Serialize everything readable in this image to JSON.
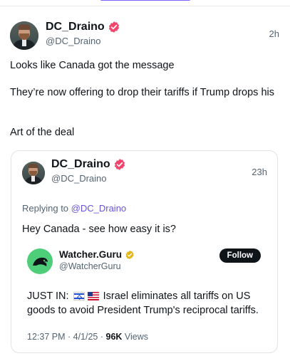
{
  "post": {
    "display_name": "DC_Draino",
    "handle": "@DC_Draino",
    "time": "2h",
    "text_lines": [
      "Looks like Canada got the message",
      "They’re now offering to drop their tariffs if Trump drops his",
      "Art of the deal"
    ]
  },
  "quoted": {
    "display_name": "DC_Draino",
    "handle": "@DC_Draino",
    "time": "23h",
    "reply_prefix": "Replying to ",
    "reply_mention": "@DC_Draino",
    "text": "Hey Canada - see how easy it is?",
    "embedded": {
      "display_name": "Watcher.Guru",
      "handle": "@WatcherGuru",
      "follow_label": "Follow",
      "text_prefix": "JUST IN: ",
      "text_body": " Israel eliminates all tariffs on US goods to avoid President Trump's reciprocal tariffs."
    },
    "meta": {
      "time": "12:37 PM",
      "sep1": " · ",
      "date": "4/1/25",
      "sep2": " · ",
      "views_count": "96K",
      "views_label": " Views"
    }
  },
  "colors": {
    "accent": "#7b61ff",
    "verified_badge": "#f0466e",
    "mention": "#6a52d8",
    "watcher_avatar": "#4fce7a"
  },
  "icons": [
    "verified-badge-icon",
    "gold-verified-badge-icon",
    "israel-flag-icon",
    "us-flag-icon"
  ]
}
